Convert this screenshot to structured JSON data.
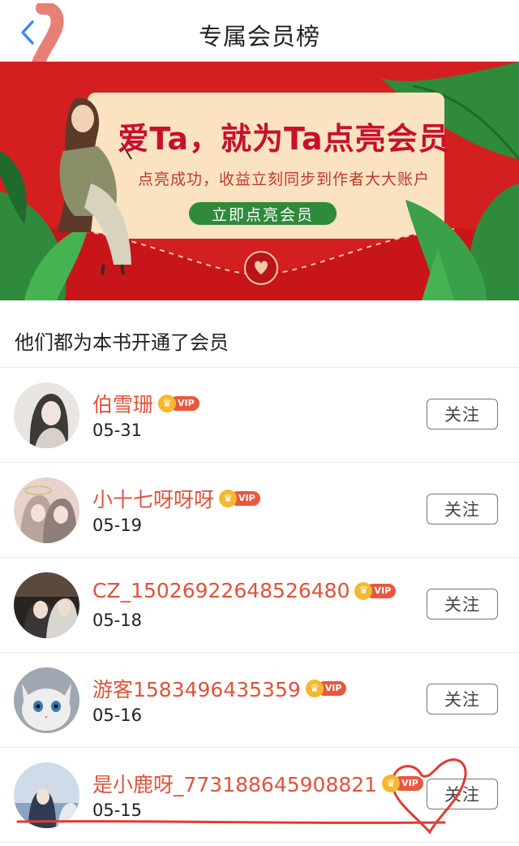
{
  "header": {
    "title": "专属会员榜"
  },
  "banner": {
    "title": "爱Ta，就为Ta点亮会员",
    "subtitle": "点亮成功，收益立刻同步到作者大大账户",
    "button_label": "立即点亮会员"
  },
  "section": {
    "title": "他们都为本书开通了会员"
  },
  "vip_label": "VIP",
  "follow_label": "关注",
  "members": [
    {
      "name": "伯雪珊",
      "date": "05-31",
      "avatar": "avatar-1"
    },
    {
      "name": "小十七呀呀呀",
      "date": "05-19",
      "avatar": "avatar-2"
    },
    {
      "name": "CZ_15026922648526480",
      "date": "05-18",
      "avatar": "avatar-3"
    },
    {
      "name": "游客1583496435359",
      "date": "05-16",
      "avatar": "avatar-4"
    },
    {
      "name": "是小鹿呀_773188645908821",
      "date": "05-15",
      "avatar": "avatar-5"
    }
  ],
  "colors": {
    "banner_red": "#d41f20",
    "name_orange": "#e0533a",
    "vip_badge": "#e9573f",
    "crown_gold": "#f5b82e",
    "banner_button_green": "#2f8a3c"
  }
}
